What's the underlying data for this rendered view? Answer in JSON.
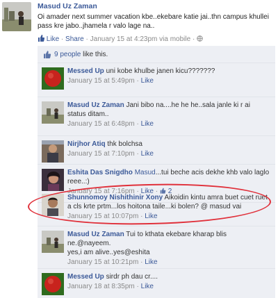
{
  "post": {
    "author": "Masud Uz Zaman",
    "text": "Oi amader next summer vacation kbe..ekebare katie jai..thn campus khullei pass kre jabo..jhamela r valo lage na..",
    "like_label": "Like",
    "share_label": "Share",
    "dot": "·",
    "timestamp": "January 15 at 4:23pm via mobile",
    "icons": [
      "like-icon",
      "share-icon",
      "globe-icon"
    ]
  },
  "likes": {
    "count_label": "9 people",
    "suffix": " like this."
  },
  "comments": [
    {
      "author": "Messed Up",
      "text": "uni kobe khulbe janen kicu???????",
      "time": "January 15 at 5:49pm",
      "like_label": "Like"
    },
    {
      "author": "Masud Uz Zaman",
      "text": "Jani bibo na....he he he..sala janle ki r ai status ditam..",
      "time": "January 15 at 6:48pm",
      "like_label": "Like"
    },
    {
      "author": "Nirjhor Atiq",
      "text": "thk bolchsa",
      "time": "January 15 at 7:10pm",
      "like_label": "Like"
    },
    {
      "author": "Eshita Das Snigdho",
      "mention": "Masud",
      "text": "...tui beche acis dekhe khb valo laglo reee..:)",
      "time": "January 15 at 7:16pm",
      "like_label": "Like",
      "like_count": "2"
    },
    {
      "author": "Shunnomoy Nishithinir Xony",
      "text": "Aikoidin kintu amra buet cuet ruet a cls krte prtm...los hoitona taile...ki bolen? @ masud vai",
      "time": "January 15 at 10:07pm",
      "like_label": "Like"
    },
    {
      "author": "Masud Uz Zaman",
      "text": "Tui to kthata ekebare kharap blis ne.@nayeem.",
      "text2": "yes,i am alive..yes@eshita",
      "time": "January 15 at 10:21pm",
      "like_label": "Like"
    },
    {
      "author": "Messed Up",
      "text": "sirdr ph dau cr....",
      "time": "January 18 at 8:35pm",
      "like_label": "Like"
    }
  ],
  "colors": {
    "link": "#3b5998",
    "panel": "#edeff4",
    "highlight": "#e0303a"
  }
}
